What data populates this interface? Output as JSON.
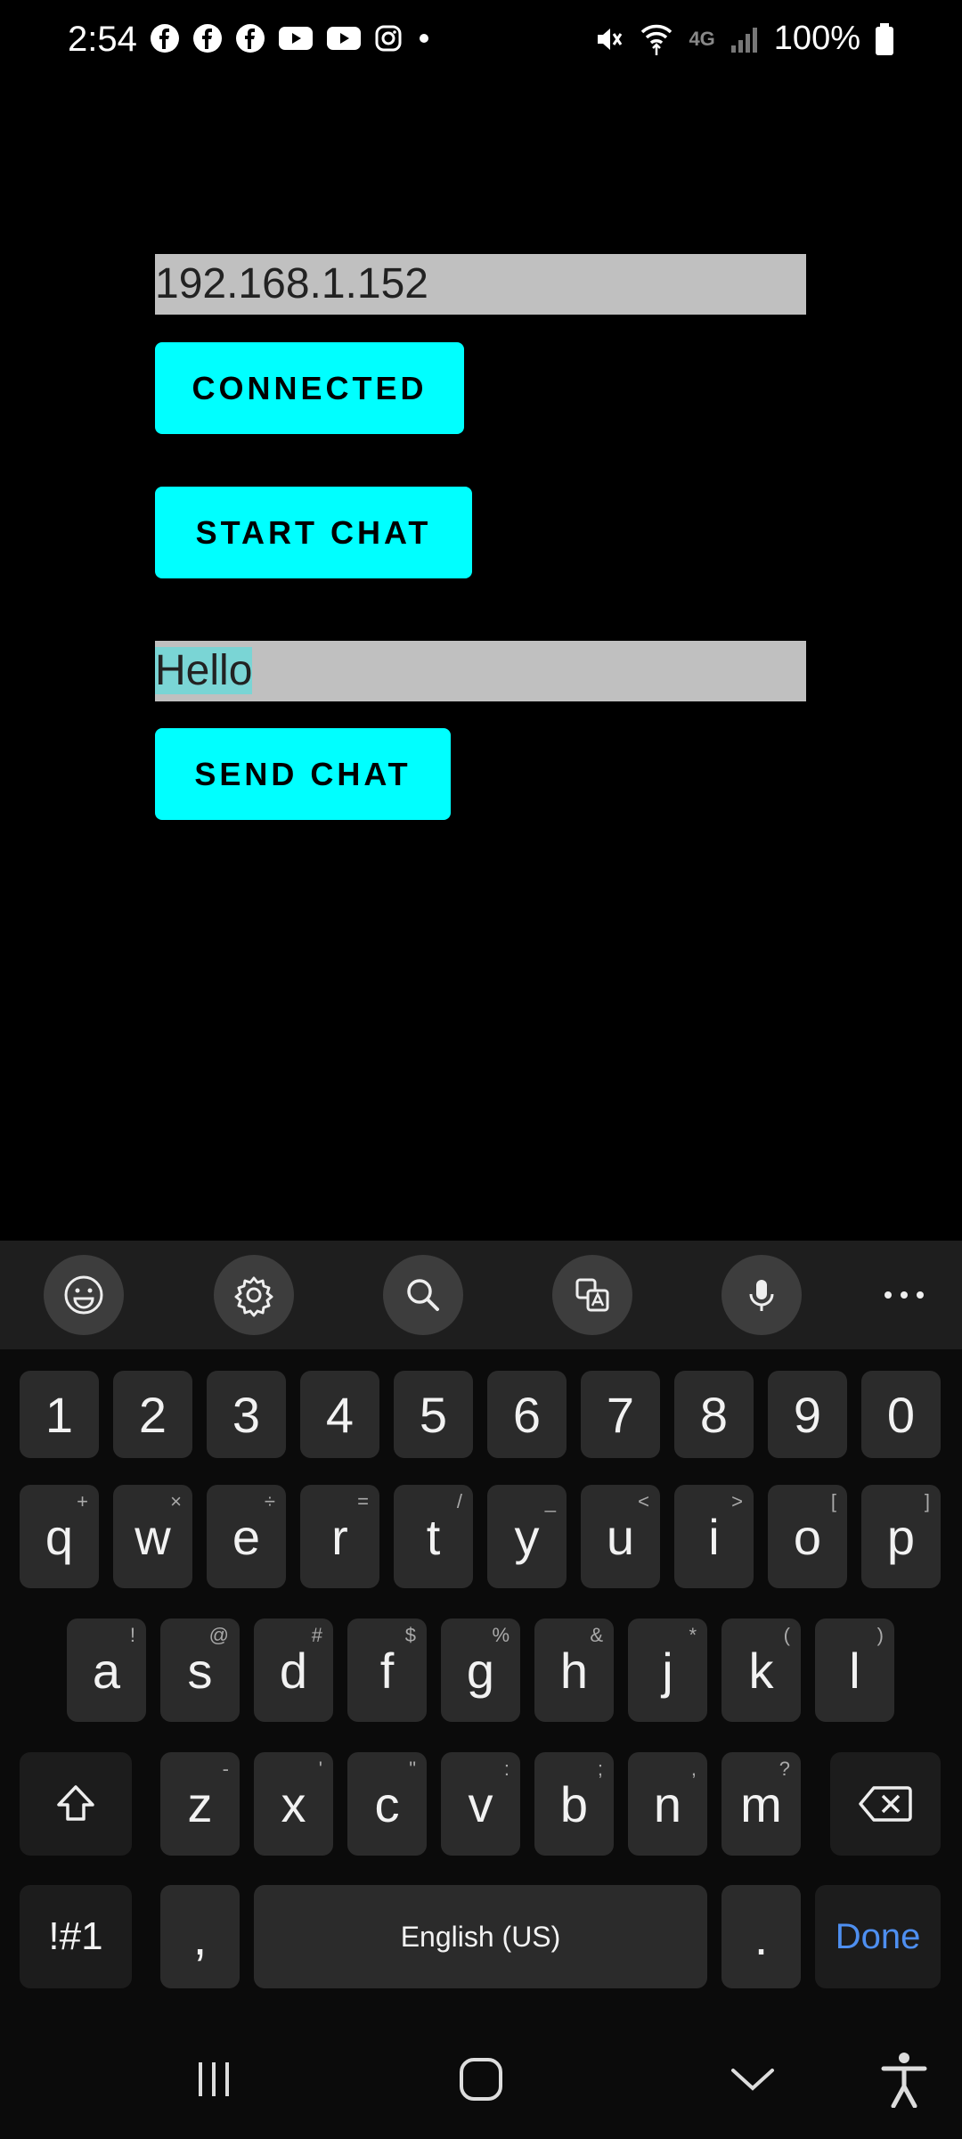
{
  "status_bar": {
    "time": "2:54",
    "network": "4G",
    "battery": "100%",
    "app_icons": [
      "facebook-icon",
      "facebook-icon",
      "facebook-icon",
      "youtube-icon",
      "youtube-icon",
      "instagram-icon",
      "dot-icon"
    ]
  },
  "main": {
    "ip_field_value": "192.168.1.152",
    "connected_label": "CONNECTED",
    "start_chat_label": "START CHAT",
    "message_field_value": "Hello",
    "send_chat_label": "SEND CHAT"
  },
  "keyboard": {
    "number_row": [
      "1",
      "2",
      "3",
      "4",
      "5",
      "6",
      "7",
      "8",
      "9",
      "0"
    ],
    "row1": [
      {
        "key": "q",
        "sub": "+"
      },
      {
        "key": "w",
        "sub": "×"
      },
      {
        "key": "e",
        "sub": "÷"
      },
      {
        "key": "r",
        "sub": "="
      },
      {
        "key": "t",
        "sub": "/"
      },
      {
        "key": "y",
        "sub": "_"
      },
      {
        "key": "u",
        "sub": "<"
      },
      {
        "key": "i",
        "sub": ">"
      },
      {
        "key": "o",
        "sub": "["
      },
      {
        "key": "p",
        "sub": "]"
      }
    ],
    "row2": [
      {
        "key": "a",
        "sub": "!"
      },
      {
        "key": "s",
        "sub": "@"
      },
      {
        "key": "d",
        "sub": "#"
      },
      {
        "key": "f",
        "sub": "$"
      },
      {
        "key": "g",
        "sub": "%"
      },
      {
        "key": "h",
        "sub": "&"
      },
      {
        "key": "j",
        "sub": "*"
      },
      {
        "key": "k",
        "sub": "("
      },
      {
        "key": "l",
        "sub": ")"
      }
    ],
    "row3": [
      {
        "key": "z",
        "sub": "-"
      },
      {
        "key": "x",
        "sub": "'"
      },
      {
        "key": "c",
        "sub": "\""
      },
      {
        "key": "v",
        "sub": ":"
      },
      {
        "key": "b",
        "sub": ";"
      },
      {
        "key": "n",
        "sub": ","
      },
      {
        "key": "m",
        "sub": "?"
      }
    ],
    "symbols_label": "!#1",
    "comma_label": ",",
    "space_label": "English (US)",
    "period_label": ".",
    "done_label": "Done",
    "accent_color": "#4e8ff0"
  },
  "colors": {
    "button_cyan": "#00ffff",
    "field_gray": "#c0c0c0",
    "selection": "#7ad5d5"
  }
}
